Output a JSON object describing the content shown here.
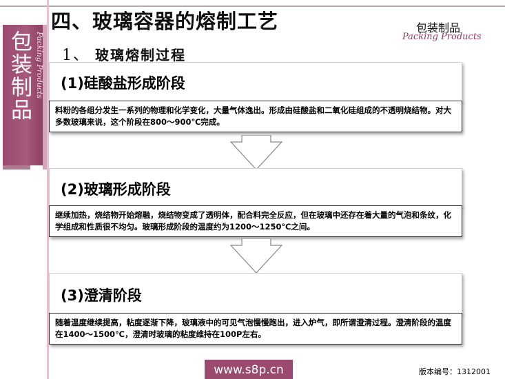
{
  "title": "四、玻璃容器的熔制工艺",
  "subtitle_number": "1、",
  "subtitle_text": "玻璃熔制过程",
  "brand": {
    "name": "包装制品",
    "script": "Packing Products"
  },
  "side_band": {
    "vertical_text": "包装制品",
    "script": "Packing Products"
  },
  "stages": [
    {
      "label": "(1)硅酸盐形成阶段",
      "body": "料粉的各组分发生一系列的物理和化学变化，大量气体逸出。形成由硅酸盐和二氧化硅组成的不透明烧结物。对大多数玻璃来说，这个阶段在800～900℃完成。"
    },
    {
      "label": "(2)玻璃形成阶段",
      "body": "继续加热，烧结物开始熔融，烧结物变成了透明体，配合料完全反应，但在玻璃中还存在着大量的气泡和条纹，化学组成和性质很不均匀。玻璃形成阶段的温度约为1200～1250℃之间。"
    },
    {
      "label": "(3)澄清阶段",
      "body": "随着温度继续提高，粘度逐渐下降，玻璃液中的可见气泡慢慢跑出，进入炉气，即所谓澄清过程。澄清阶段的温度在1400～1500℃，澄清时玻璃的粘度维持在100P左右。"
    }
  ],
  "footer": {
    "url": "www.s8p.cn",
    "version": "版本编号：1312001"
  },
  "colors": {
    "band": "#9a4a6f",
    "accent": "#d6a4bb"
  }
}
